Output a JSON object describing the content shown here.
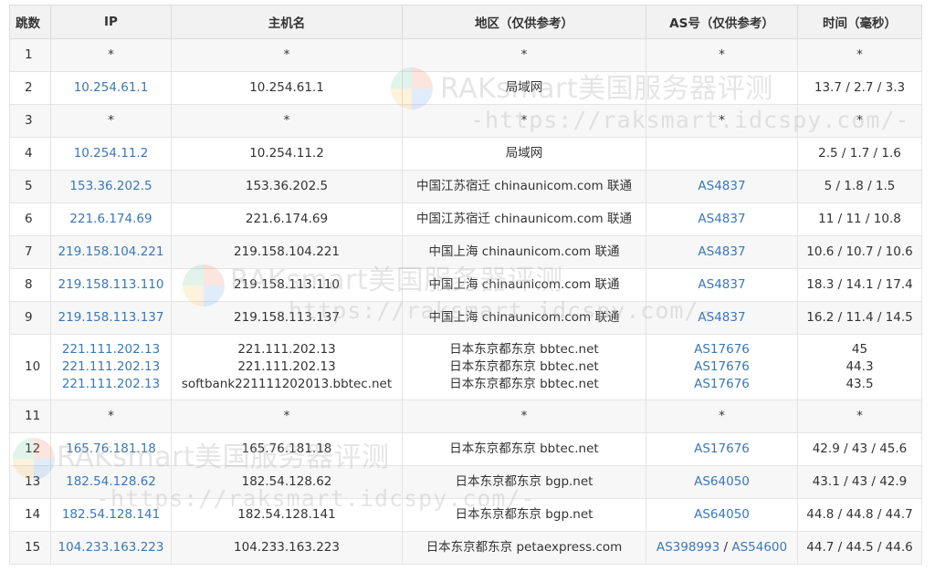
{
  "headers": {
    "hop": "跳数",
    "ip": "IP",
    "host": "主机名",
    "region": "地区（仅供参考）",
    "as": "AS号（仅供参考）",
    "time": "时间（毫秒）"
  },
  "watermark": {
    "title": "RAKsmart美国服务器评测",
    "url": "-https://raksmart.idcspy.com/-"
  },
  "rows": [
    {
      "hop": "1",
      "ip": "*",
      "host": "*",
      "region": "*",
      "as": "*",
      "time": "*"
    },
    {
      "hop": "2",
      "ip": "10.254.61.1",
      "host": "10.254.61.1",
      "region": "局域网",
      "as": "",
      "time": "13.7 / 2.7 / 3.3"
    },
    {
      "hop": "3",
      "ip": "*",
      "host": "*",
      "region": "*",
      "as": "*",
      "time": "*"
    },
    {
      "hop": "4",
      "ip": "10.254.11.2",
      "host": "10.254.11.2",
      "region": "局域网",
      "as": "",
      "time": "2.5 / 1.7 / 1.6"
    },
    {
      "hop": "5",
      "ip": "153.36.202.5",
      "host": "153.36.202.5",
      "region": "中国江苏宿迁 chinaunicom.com 联通",
      "as": "AS4837",
      "time": "5 / 1.8 / 1.5"
    },
    {
      "hop": "6",
      "ip": "221.6.174.69",
      "host": "221.6.174.69",
      "region": "中国江苏宿迁 chinaunicom.com 联通",
      "as": "AS4837",
      "time": "11 / 11 / 10.8"
    },
    {
      "hop": "7",
      "ip": "219.158.104.221",
      "host": "219.158.104.221",
      "region": "中国上海 chinaunicom.com 联通",
      "as": "AS4837",
      "time": "10.6 / 10.7 / 10.6"
    },
    {
      "hop": "8",
      "ip": "219.158.113.110",
      "host": "219.158.113.110",
      "region": "中国上海 chinaunicom.com 联通",
      "as": "AS4837",
      "time": "18.3 / 14.1 / 17.4"
    },
    {
      "hop": "9",
      "ip": "219.158.113.137",
      "host": "219.158.113.137",
      "region": "中国上海 chinaunicom.com 联通",
      "as": "AS4837",
      "time": "16.2 / 11.4 / 14.5"
    },
    {
      "hop": "10",
      "ip_lines": [
        "221.111.202.13",
        "221.111.202.13",
        "221.111.202.13"
      ],
      "host_lines": [
        "221.111.202.13",
        "221.111.202.13",
        "softbank221111202013.bbtec.net"
      ],
      "region_lines": [
        "日本东京都东京 bbtec.net",
        "日本东京都东京 bbtec.net",
        "日本东京都东京 bbtec.net"
      ],
      "as_lines": [
        "AS17676",
        "AS17676",
        "AS17676"
      ],
      "time_lines": [
        "45",
        "44.3",
        "43.5"
      ]
    },
    {
      "hop": "11",
      "ip": "*",
      "host": "*",
      "region": "*",
      "as": "*",
      "time": "*"
    },
    {
      "hop": "12",
      "ip": "165.76.181.18",
      "host": "165.76.181.18",
      "region": "日本东京都东京 bbtec.net",
      "as": "AS17676",
      "time": "42.9 / 43 / 45.6"
    },
    {
      "hop": "13",
      "ip": "182.54.128.62",
      "host": "182.54.128.62",
      "region": "日本东京都东京 bgp.net",
      "as": "AS64050",
      "time": "43.1 / 43 / 42.9"
    },
    {
      "hop": "14",
      "ip": "182.54.128.141",
      "host": "182.54.128.141",
      "region": "日本东京都东京 bgp.net",
      "as": "AS64050",
      "time": "44.8 / 44.8 / 44.7"
    },
    {
      "hop": "15",
      "ip": "104.233.163.223",
      "host": "104.233.163.223",
      "region": "日本东京都东京 petaexpress.com",
      "as_a": "AS398993",
      "as_sep": " / ",
      "as_b": "AS54600",
      "time": "44.7 / 44.5 / 44.6"
    }
  ]
}
